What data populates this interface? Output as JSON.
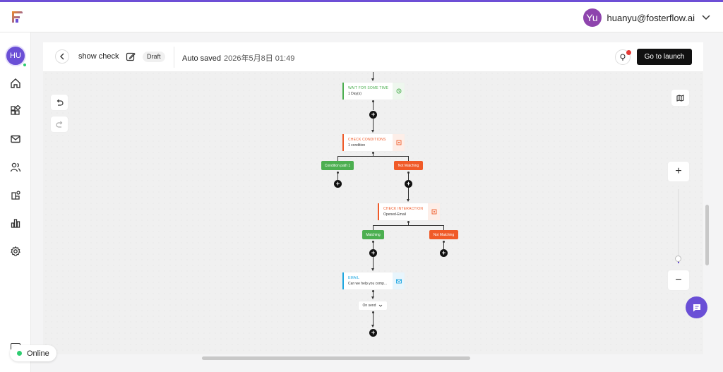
{
  "header": {
    "user_initials": "Yu",
    "user_email": "huanyu@fosterflow.ai",
    "avatar_color": "#8e44ad"
  },
  "sidebar": {
    "avatar_initials": "HU",
    "items": [
      {
        "icon": "home-icon"
      },
      {
        "icon": "apps-icon"
      },
      {
        "icon": "mail-icon"
      },
      {
        "icon": "users-icon"
      },
      {
        "icon": "integrations-icon"
      },
      {
        "icon": "analytics-icon"
      },
      {
        "icon": "settings-icon"
      }
    ],
    "status": "Online"
  },
  "toolbar": {
    "flow_name": "show check",
    "status_badge": "Draft",
    "autosave_label": "Auto saved",
    "autosave_time": "2026年5月8日 01:49",
    "launch_label": "Go to launch"
  },
  "zoom": {
    "in_label": "+",
    "out_label": "−"
  },
  "flow": {
    "wait_node": {
      "title": "WAIT FOR SOME TIME",
      "subtitle": "1 Day(s)",
      "color": "#4caf50"
    },
    "check_conditions": {
      "title": "CHECK CONDITIONS",
      "subtitle": "1 condition",
      "color": "#f05a28"
    },
    "condition_path": {
      "label": "Condition path 1",
      "color": "#4caf50"
    },
    "not_matching_1": {
      "label": "Not Matching",
      "color": "#f05a28"
    },
    "check_interaction": {
      "title": "CHECK INTERACTION",
      "subtitle": "Opened-Email",
      "color": "#f05a28"
    },
    "matching": {
      "label": "Matching",
      "color": "#4caf50"
    },
    "not_matching_2": {
      "label": "Not Matching",
      "color": "#f05a28"
    },
    "email_node": {
      "title": "EMAIL",
      "subtitle": "Can we help you comp...",
      "color": "#1ea7e1"
    },
    "send_option": "On send"
  },
  "colors": {
    "accent": "#6a4fd6",
    "brand_bar": "#6d4fd6"
  }
}
